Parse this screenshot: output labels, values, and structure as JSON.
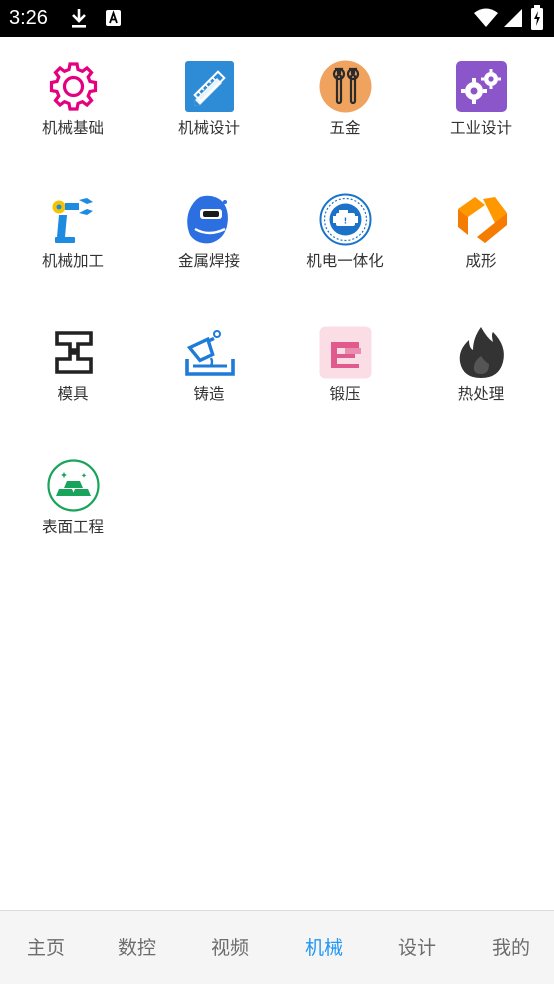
{
  "status_bar": {
    "time": "3:26",
    "icons": [
      "download-icon",
      "a-badge-icon",
      "wifi-icon",
      "signal-icon",
      "battery-charging-icon"
    ]
  },
  "categories": [
    {
      "label": "机械基础",
      "icon": "gear-icon",
      "color": "#e4007f"
    },
    {
      "label": "机械设计",
      "icon": "ruler-pencil-icon",
      "color": "#2e8bd6"
    },
    {
      "label": "五金",
      "icon": "wrench-icon",
      "color": "#f0a35e"
    },
    {
      "label": "工业设计",
      "icon": "gears-icon",
      "color": "#8a56c9"
    },
    {
      "label": "机械加工",
      "icon": "robot-arm-icon",
      "color": "#1d8be0"
    },
    {
      "label": "金属焊接",
      "icon": "welding-mask-icon",
      "color": "#2b6fe0"
    },
    {
      "label": "机电一体化",
      "icon": "engine-badge-icon",
      "color": "#1a73c9"
    },
    {
      "label": "成形",
      "icon": "fold-shape-icon",
      "color": "#ff9800"
    },
    {
      "label": "模具",
      "icon": "mold-icon",
      "color": "#222222"
    },
    {
      "label": "铸造",
      "icon": "casting-icon",
      "color": "#1f7ad8"
    },
    {
      "label": "锻压",
      "icon": "forging-press-icon",
      "color": "#e05a8e"
    },
    {
      "label": "热处理",
      "icon": "flame-icon",
      "color": "#333333"
    },
    {
      "label": "表面工程",
      "icon": "gold-bars-icon",
      "color": "#1aa35a"
    }
  ],
  "tabs": [
    {
      "label": "主页",
      "active": false
    },
    {
      "label": "数控",
      "active": false
    },
    {
      "label": "视频",
      "active": false
    },
    {
      "label": "机械",
      "active": true
    },
    {
      "label": "设计",
      "active": false
    },
    {
      "label": "我的",
      "active": false
    }
  ],
  "accent_color": "#2196f3"
}
